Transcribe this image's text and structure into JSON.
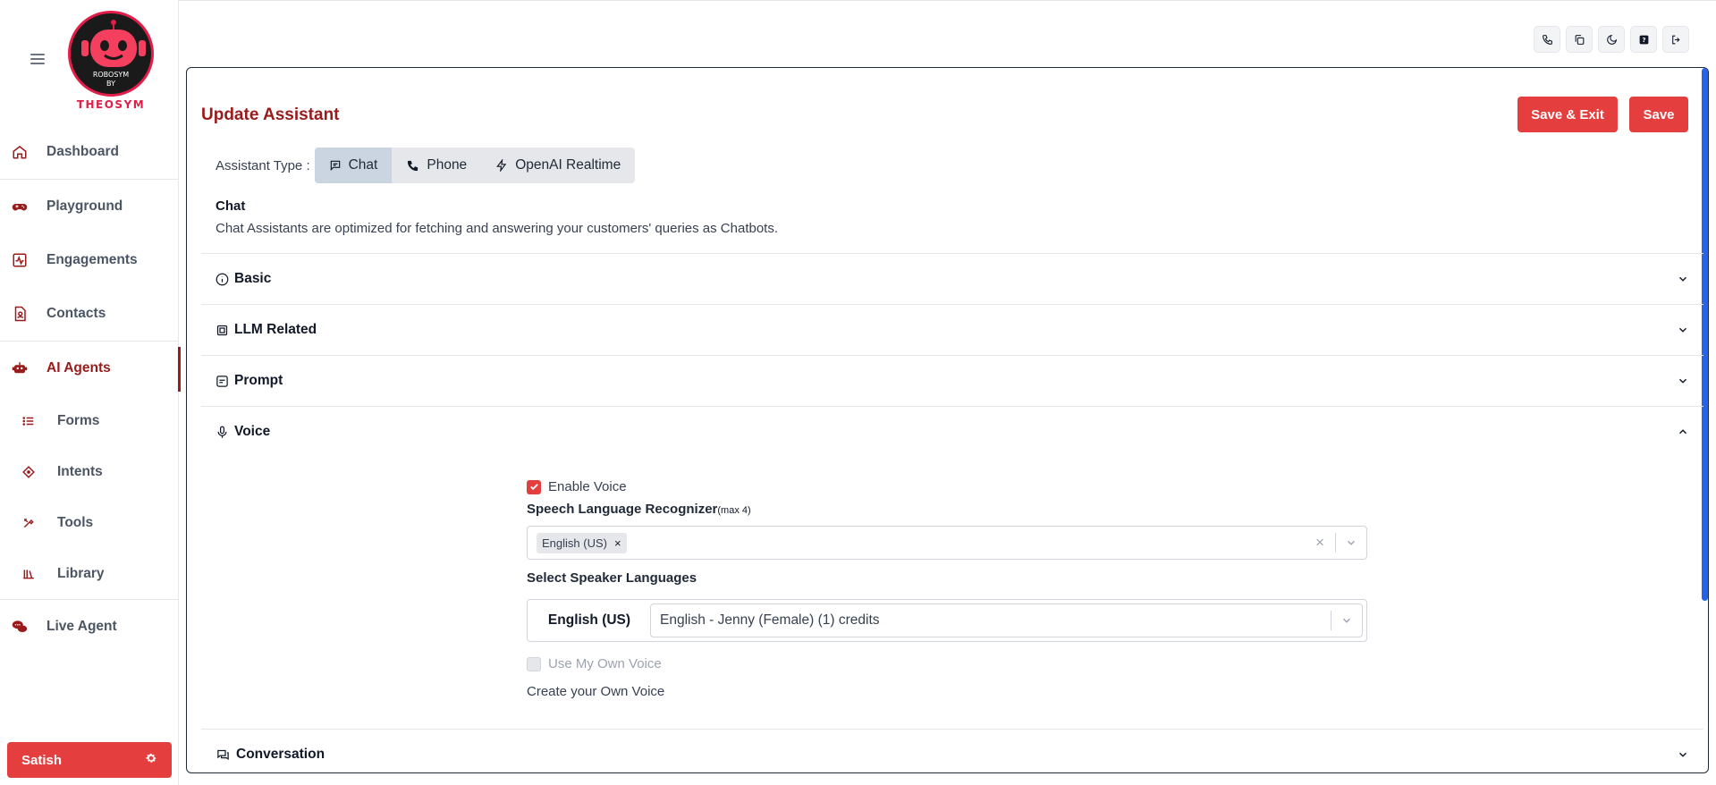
{
  "brand": {
    "logo_text": "THEOSYM",
    "logo_inner_top": "ROBOSYM",
    "logo_inner_bottom": "BY"
  },
  "sidebar": {
    "items": [
      {
        "label": "Dashboard"
      },
      {
        "label": "Playground"
      },
      {
        "label": "Engagements"
      },
      {
        "label": "Contacts"
      },
      {
        "label": "AI Agents"
      },
      {
        "label": "Forms"
      },
      {
        "label": "Intents"
      },
      {
        "label": "Tools"
      },
      {
        "label": "Library"
      },
      {
        "label": "Live Agent"
      }
    ],
    "active": "AI Agents",
    "user": {
      "name": "Satish"
    }
  },
  "topbar": {
    "icons": [
      "phone-icon",
      "copy-icon",
      "moon-icon",
      "help-icon",
      "logout-icon"
    ]
  },
  "page": {
    "title": "Update Assistant",
    "save_exit_label": "Save & Exit",
    "save_label": "Save",
    "assistant_type": {
      "label": "Assistant Type :",
      "options": [
        "Chat",
        "Phone",
        "OpenAI Realtime"
      ],
      "selected": "Chat"
    },
    "type_info": {
      "title": "Chat",
      "description": "Chat Assistants are optimized for fetching and answering your customers' queries as Chatbots."
    },
    "sections": [
      {
        "title": "Basic",
        "expanded": false
      },
      {
        "title": "LLM Related",
        "expanded": false
      },
      {
        "title": "Prompt",
        "expanded": false
      },
      {
        "title": "Voice",
        "expanded": true
      },
      {
        "title": "Conversation",
        "expanded": false
      }
    ],
    "voice": {
      "enable_voice_label": "Enable Voice",
      "enable_voice_checked": true,
      "recognizer_label": "Speech Language Recognizer",
      "recognizer_hint": "(max 4)",
      "recognizer_selected": [
        "English (US)"
      ],
      "speaker_label": "Select Speaker Languages",
      "speaker_language": "English (US)",
      "speaker_voice": "English - Jenny (Female) (1) credits",
      "own_voice_label": "Use My Own Voice",
      "own_voice_checked": false,
      "create_voice_label": "Create your Own Voice"
    }
  },
  "colors": {
    "accent": "#e53e3e",
    "title": "#991b1b",
    "scroll": "#2563eb"
  }
}
